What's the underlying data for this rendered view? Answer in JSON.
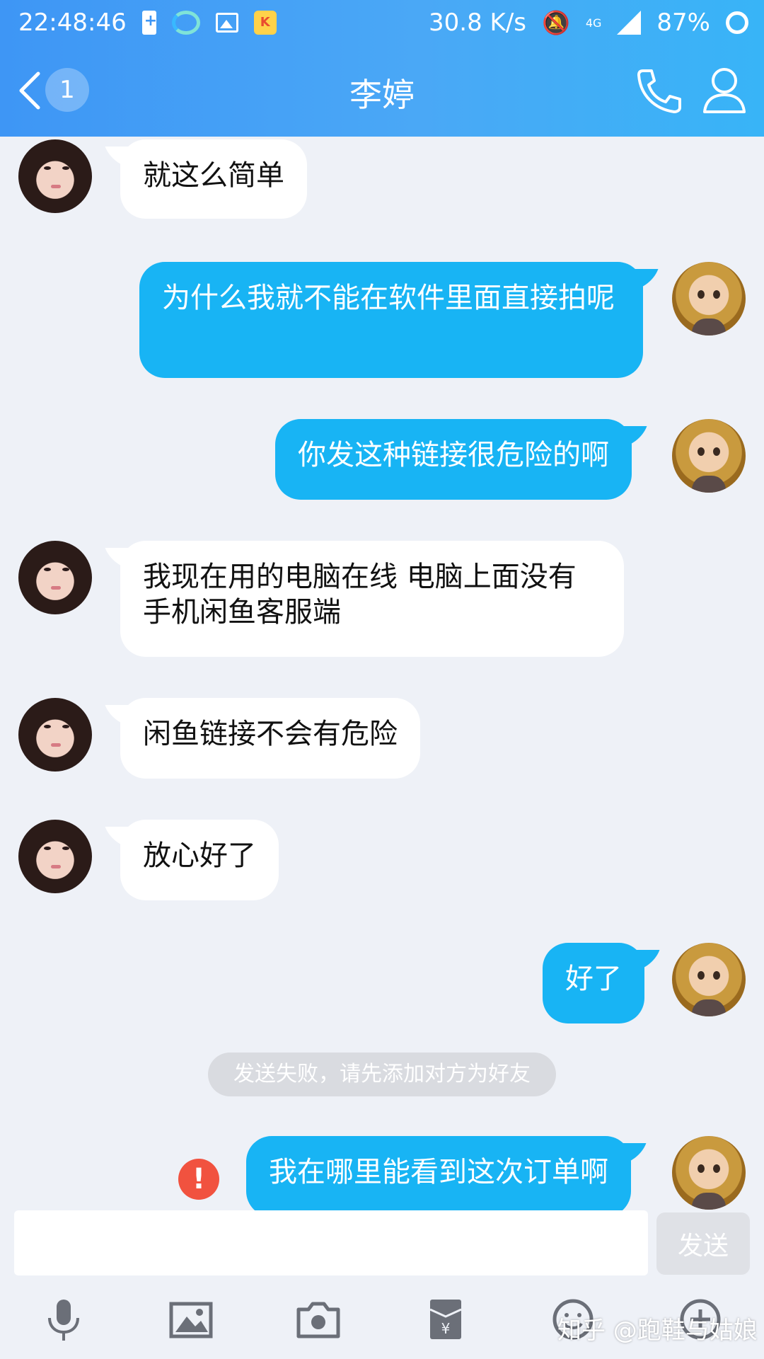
{
  "status_bar": {
    "time": "22:48:46",
    "net_speed": "30.8 K/s",
    "network_type": "4G",
    "battery": "87%"
  },
  "header": {
    "unread_count": "1",
    "title": "李婷"
  },
  "messages": [
    {
      "side": "in",
      "text": "就这么简单"
    },
    {
      "side": "out",
      "text": "为什么我就不能在软件里面直接拍呢"
    },
    {
      "side": "out",
      "text": "你发这种链接很危险的啊"
    },
    {
      "side": "in",
      "text": "我现在用的电脑在线 电脑上面没有手机闲鱼客服端"
    },
    {
      "side": "in",
      "text": "闲鱼链接不会有危险"
    },
    {
      "side": "in",
      "text": "放心好了"
    },
    {
      "side": "out",
      "text": "好了"
    },
    {
      "side": "out",
      "text": "我在哪里能看到这次订单啊",
      "failed": true
    }
  ],
  "system_notice": "发送失败，请先添加对方为好友",
  "error_icon_glyph": "!",
  "input": {
    "value": "",
    "send_label": "发送"
  },
  "toolbar": {
    "icons": [
      "microphone-icon",
      "image-icon",
      "camera-icon",
      "red-packet-icon",
      "emoji-icon",
      "plus-icon"
    ]
  },
  "watermark": "知乎 @跑鞋与姑娘",
  "colors": {
    "header_gradient_start": "#3e96f5",
    "header_gradient_end": "#38b4f7",
    "outgoing_bubble": "#18b4f4",
    "incoming_bubble": "#ffffff",
    "background": "#eef1f7",
    "error": "#f1523f"
  }
}
